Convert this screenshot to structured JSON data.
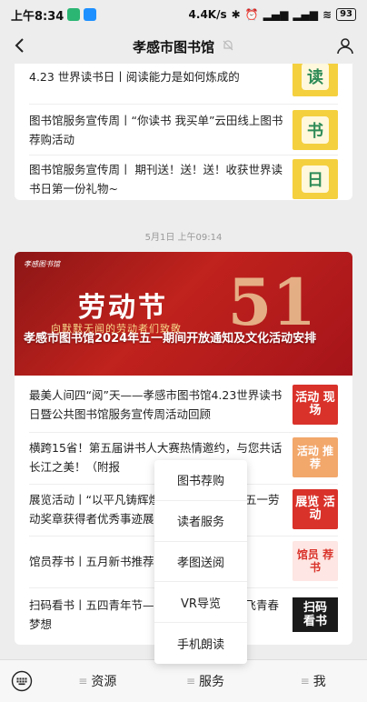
{
  "status": {
    "time": "上午8:34",
    "net_speed": "4.4K/s",
    "battery": "93"
  },
  "nav": {
    "title": "孝感市图书馆"
  },
  "card1": {
    "items": [
      {
        "title": "4.23 世界读书日丨阅读能力是如何炼成的",
        "thumb": "读"
      },
      {
        "title": "图书馆服务宣传周丨“你读书 我买单”云田线上图书荐购活动",
        "thumb": "书"
      },
      {
        "title": "图书馆服务宣传周丨 期刊送！送！送！收获世界读书日第一份礼物~",
        "thumb": "日"
      }
    ]
  },
  "timestamp": "5月1日 上午09:14",
  "banner": {
    "logo": "孝感图书馆",
    "big": "劳动节",
    "sub": "向默默无闻的劳动者们致敬",
    "num": "51",
    "title": "孝感市图书馆2024年五一期间开放通知及文化活动安排"
  },
  "card2": {
    "items": [
      {
        "title": "最美人间四“阅”天——孝感市图书馆4.23世界读书日暨公共图书馆服务宣传周活动回顾",
        "thumb": "活动 现场"
      },
      {
        "title": "横跨15省！第五届讲书人大赛热情邀约，与您共话长江之美！（附报",
        "thumb": "活动 推荐"
      },
      {
        "title": "展览活动丨“以平凡铸辉煌”——第三届湖北五一劳动奖章获得者优秀事迹展",
        "thumb": "展览 活动"
      },
      {
        "title": "馆员荐书丨五月新书推荐",
        "thumb": "馆员 荐书"
      },
      {
        "title": "扫码看书丨五四青年节——以青春之名，放飞青春梦想",
        "thumb": "扫码 看书"
      }
    ]
  },
  "popup": {
    "items": [
      "图书荐购",
      "读者服务",
      "孝图送阅",
      "VR导览",
      "手机朗读"
    ]
  },
  "bottom": {
    "menus": [
      "资源",
      "服务",
      "我"
    ]
  },
  "colors": {
    "accent_red": "#d9322a",
    "banner_red": "#c0221d"
  }
}
